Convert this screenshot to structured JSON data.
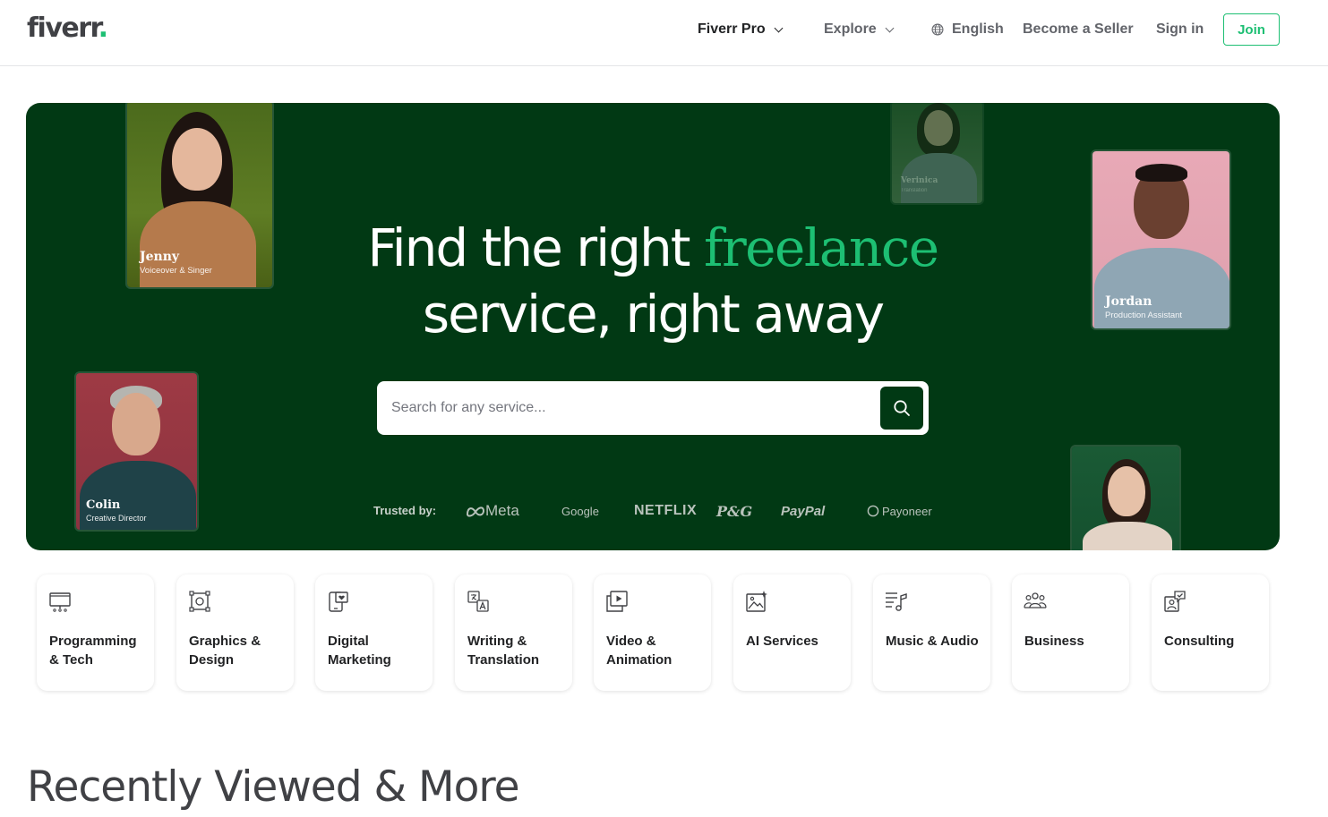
{
  "header": {
    "logo": "fiverr",
    "logo_dot": ".",
    "nav": {
      "fiverr_pro": "Fiverr Pro",
      "explore": "Explore",
      "language": "English",
      "become_seller": "Become a Seller",
      "sign_in": "Sign in",
      "join": "Join"
    }
  },
  "hero": {
    "title_part1": "Find the right ",
    "title_accent": "freelance",
    "title_part2": "service, right away",
    "search": {
      "placeholder": "Search for any service..."
    },
    "trusted_label": "Trusted by:",
    "brands": [
      "Meta",
      "Google",
      "NETFLIX",
      "P&G",
      "PayPal",
      "Payoneer"
    ],
    "freelancers": [
      {
        "name": "Jenny",
        "role": "Voiceover & Singer"
      },
      {
        "name": "Verinica",
        "role": "Translation"
      },
      {
        "name": "Jordan",
        "role": "Production Assistant"
      },
      {
        "name": "Colin",
        "role": "Creative Director"
      }
    ]
  },
  "categories": [
    {
      "line1": "Programming",
      "line2": "& Tech",
      "icon": "monitor-icon"
    },
    {
      "line1": "Graphics &",
      "line2": "Design",
      "icon": "design-frame-icon"
    },
    {
      "line1": "Digital",
      "line2": "Marketing",
      "icon": "phone-heart-icon"
    },
    {
      "line1": "Writing &",
      "line2": "Translation",
      "icon": "translate-icon"
    },
    {
      "line1": "Video &",
      "line2": "Animation",
      "icon": "video-play-icon"
    },
    {
      "line1": "AI Services",
      "line2": "",
      "icon": "ai-image-icon"
    },
    {
      "line1": "Music & Audio",
      "line2": "",
      "icon": "music-note-icon"
    },
    {
      "line1": "Business",
      "line2": "",
      "icon": "people-icon"
    },
    {
      "line1": "Consulting",
      "line2": "",
      "icon": "consulting-chat-icon"
    }
  ],
  "section": {
    "title": "Recently Viewed & More"
  },
  "colors": {
    "brand_green": "#1dbf73",
    "hero_bg": "#013914"
  }
}
